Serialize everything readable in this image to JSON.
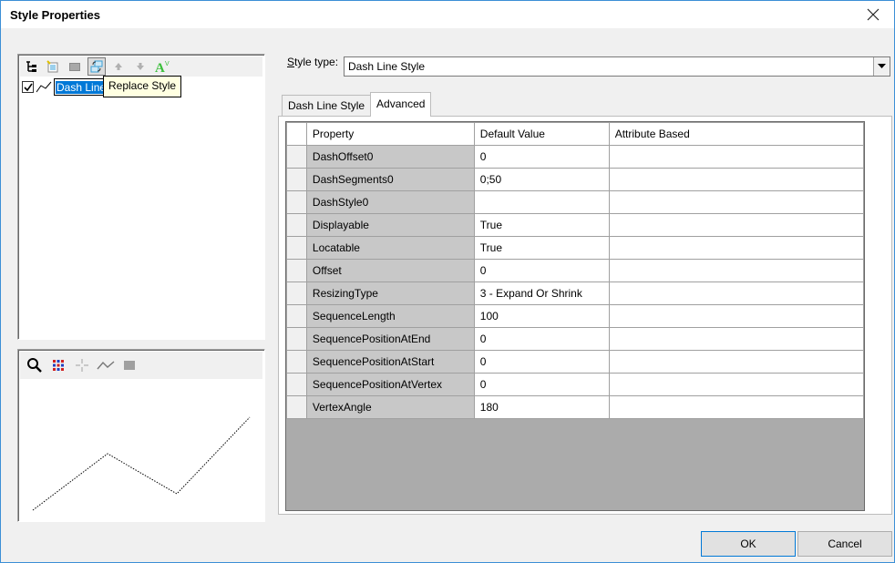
{
  "window": {
    "title": "Style Properties"
  },
  "tree": {
    "item_label": "Dash Line Style",
    "checked": true,
    "tooltip": "Replace Style"
  },
  "toolbar_icons": [
    "tree-icon",
    "new-style-icon",
    "delete-icon",
    "replace-style-icon",
    "move-up-icon",
    "move-down-icon",
    "font-style-icon"
  ],
  "preview_icons": [
    "zoom-icon",
    "palette-grid-icon",
    "point-icon",
    "line-icon",
    "area-icon"
  ],
  "style_type": {
    "label_prefix": "S",
    "label_rest": "tyle type:",
    "value": "Dash Line Style"
  },
  "tabs": [
    {
      "label": "Dash Line Style",
      "selected": false
    },
    {
      "label": "Advanced",
      "selected": true
    }
  ],
  "grid": {
    "headers": [
      "Property",
      "Default Value",
      "Attribute Based"
    ],
    "rows": [
      {
        "property": "DashOffset0",
        "value": "0",
        "attr": ""
      },
      {
        "property": "DashSegments0",
        "value": "0;50",
        "attr": ""
      },
      {
        "property": "DashStyle0",
        "value": "",
        "attr": ""
      },
      {
        "property": "Displayable",
        "value": "True",
        "attr": ""
      },
      {
        "property": "Locatable",
        "value": "True",
        "attr": ""
      },
      {
        "property": "Offset",
        "value": "0",
        "attr": ""
      },
      {
        "property": "ResizingType",
        "value": "3 - Expand Or Shrink",
        "attr": ""
      },
      {
        "property": "SequenceLength",
        "value": "100",
        "attr": ""
      },
      {
        "property": "SequencePositionAtEnd",
        "value": "0",
        "attr": ""
      },
      {
        "property": "SequencePositionAtStart",
        "value": "0",
        "attr": ""
      },
      {
        "property": "SequencePositionAtVertex",
        "value": "0",
        "attr": ""
      },
      {
        "property": "VertexAngle",
        "value": "180",
        "attr": ""
      }
    ]
  },
  "buttons": {
    "ok": "OK",
    "cancel": "Cancel"
  }
}
